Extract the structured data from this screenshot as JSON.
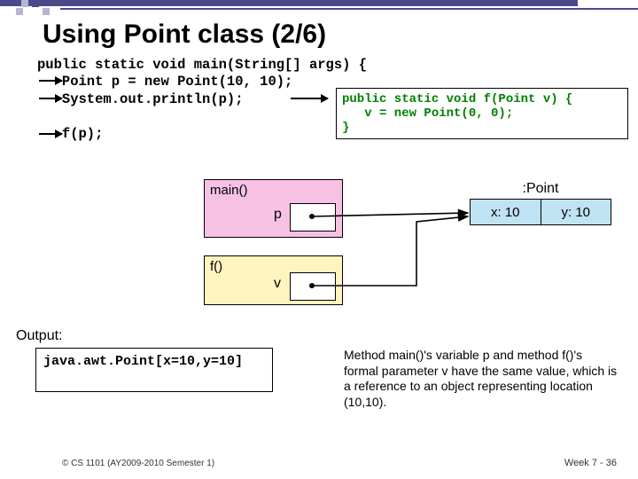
{
  "title": "Using Point class (2/6)",
  "code_main": "public static void main(String[] args) {\n   Point p = new Point(10, 10);\n   System.out.println(p);\n\n   f(p);",
  "code_f": "public static void f(Point v) {\n   v = new Point(0, 0);\n}",
  "diagram": {
    "main_label": "main()",
    "p_label": "p",
    "f_label": "f()",
    "v_label": "v",
    "point_label": ":Point",
    "x_field": "x: 10",
    "y_field": "y: 10"
  },
  "output_label": "Output:",
  "output_text": "java.awt.Point[x=10,y=10]",
  "explain": "Method main()'s variable p and method f()'s formal parameter v have the same value, which is a reference to an object representing location (10,10).",
  "footer_left": "© CS 1101 (AY2009-2010 Semester 1)",
  "footer_right": "Week 7 - 36"
}
